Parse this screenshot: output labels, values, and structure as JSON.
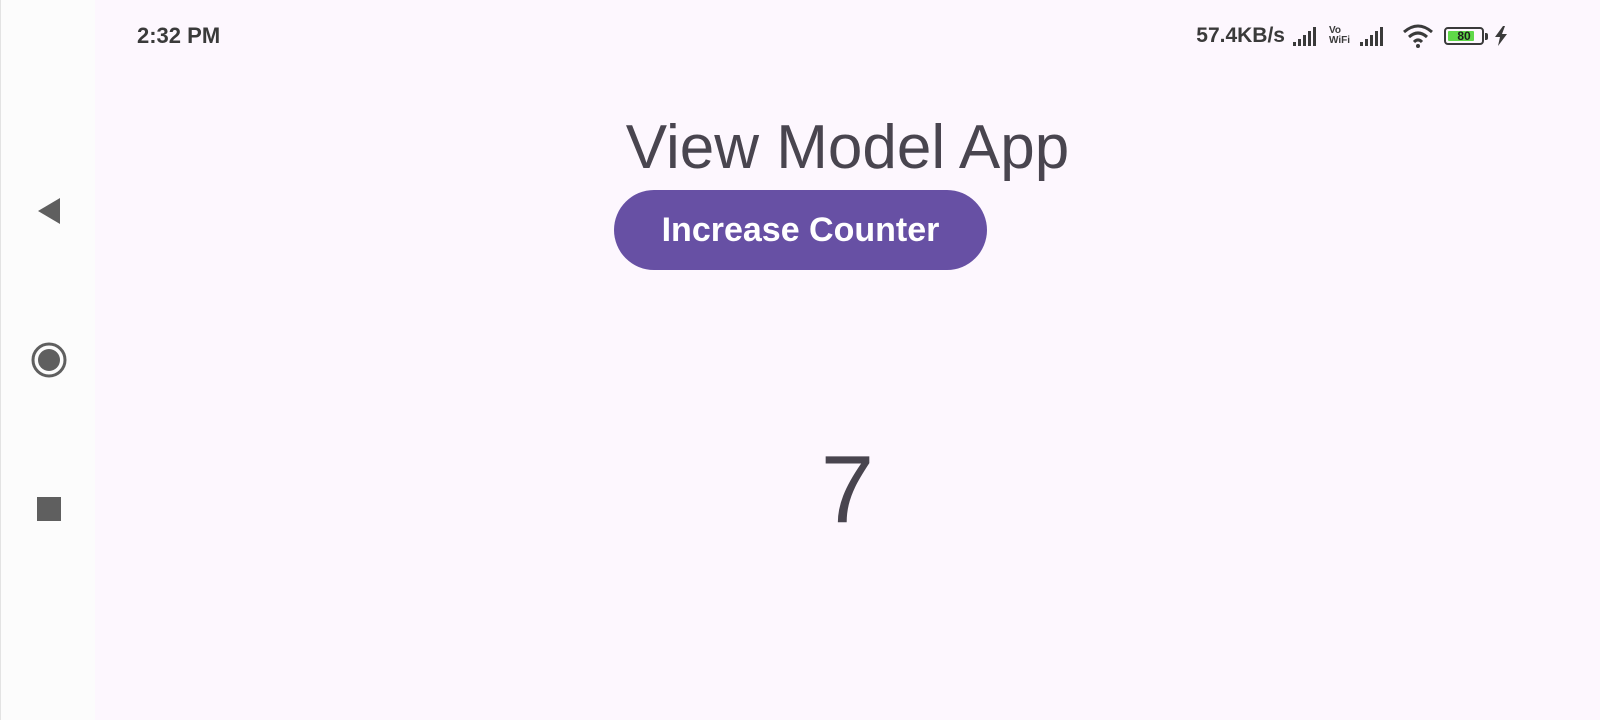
{
  "status_bar": {
    "time": "2:32 PM",
    "net_speed": "57.4KB/s",
    "vowifi_top": "Vo",
    "vowifi_bottom": "WiFi",
    "battery_level": "80",
    "battery_fraction": 0.8
  },
  "app": {
    "title": "View Model App",
    "button_label": "Increase Counter",
    "counter_value": "7"
  },
  "colors": {
    "background": "#fdf7fe",
    "primary": "#6750a4",
    "text": "#49454f",
    "battery": "#5fd848"
  },
  "icons": {
    "nav_back": "back-triangle-icon",
    "nav_home": "home-circle-icon",
    "nav_recents": "recents-square-icon",
    "signal": "signal-bars-icon",
    "wifi": "wifi-icon",
    "charging": "charging-bolt-icon"
  }
}
